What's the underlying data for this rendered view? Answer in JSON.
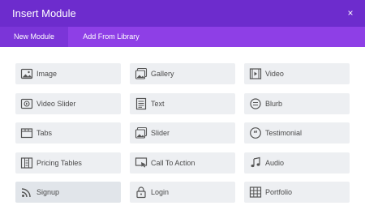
{
  "modal": {
    "title": "Insert Module",
    "close_glyph": "×"
  },
  "tabs": [
    {
      "label": "New Module",
      "active": true
    },
    {
      "label": "Add From Library",
      "active": false
    }
  ],
  "modules": [
    {
      "label": "Image",
      "icon": "image-icon"
    },
    {
      "label": "Gallery",
      "icon": "gallery-icon"
    },
    {
      "label": "Video",
      "icon": "video-icon"
    },
    {
      "label": "Video Slider",
      "icon": "video-slider-icon"
    },
    {
      "label": "Text",
      "icon": "text-icon"
    },
    {
      "label": "Blurb",
      "icon": "blurb-icon"
    },
    {
      "label": "Tabs",
      "icon": "tabs-icon"
    },
    {
      "label": "Slider",
      "icon": "slider-icon"
    },
    {
      "label": "Testimonial",
      "icon": "testimonial-icon"
    },
    {
      "label": "Pricing Tables",
      "icon": "pricing-tables-icon"
    },
    {
      "label": "Call To Action",
      "icon": "call-to-action-icon"
    },
    {
      "label": "Audio",
      "icon": "audio-icon"
    },
    {
      "label": "Signup",
      "icon": "signup-icon"
    },
    {
      "label": "Login",
      "icon": "login-icon"
    },
    {
      "label": "Portfolio",
      "icon": "portfolio-icon"
    }
  ],
  "colors": {
    "header_bg": "#6d2ccd",
    "tabs_bg": "#8e3fe6",
    "active_tab_bg": "#7b35d8",
    "tile_bg": "#edeff2",
    "tile_text": "#4a4a4a"
  }
}
